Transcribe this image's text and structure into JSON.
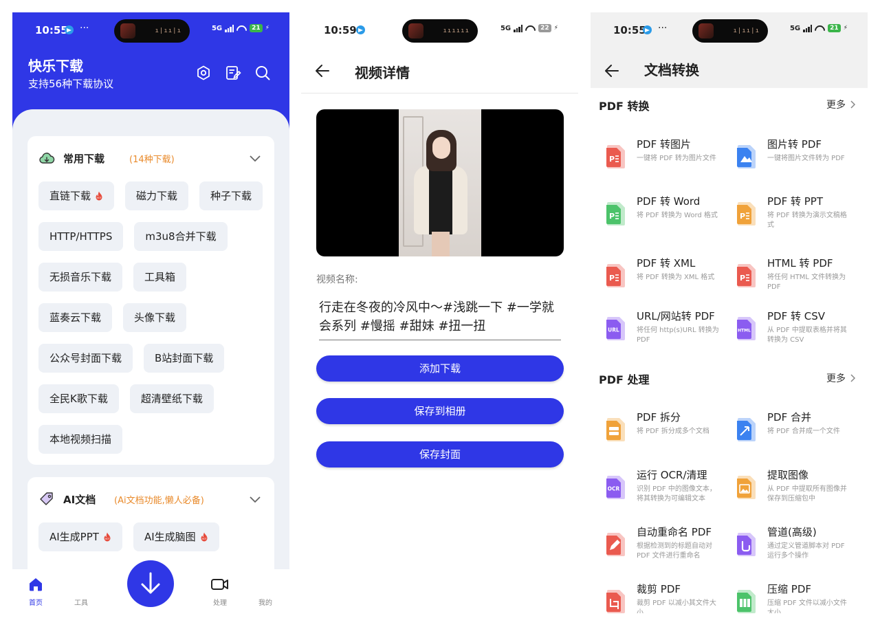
{
  "panel1": {
    "status": {
      "time": "10:55",
      "dots": "···",
      "network": "5G",
      "battery": "21"
    },
    "header": {
      "title": "快乐下载",
      "subtitle": "支持56种下载协议"
    },
    "sections": [
      {
        "title": "常用下载",
        "note": "(14种下载)",
        "chips": [
          {
            "label": "直链下载",
            "hot": true
          },
          {
            "label": "磁力下载",
            "hot": false
          },
          {
            "label": "种子下载",
            "hot": false
          },
          {
            "label": "HTTP/HTTPS",
            "hot": false
          },
          {
            "label": "m3u8合并下载",
            "hot": false
          },
          {
            "label": "无损音乐下载",
            "hot": false
          },
          {
            "label": "工具箱",
            "hot": false
          },
          {
            "label": "蓝奏云下载",
            "hot": false
          },
          {
            "label": "头像下载",
            "hot": false
          },
          {
            "label": "公众号封面下载",
            "hot": false
          },
          {
            "label": "B站封面下载",
            "hot": false
          },
          {
            "label": "全民K歌下载",
            "hot": false
          },
          {
            "label": "超清壁纸下载",
            "hot": false
          },
          {
            "label": "本地视频扫描",
            "hot": false
          }
        ]
      },
      {
        "title": "AI文档",
        "note": "(Ai文档功能,懒人必备)",
        "chips": [
          {
            "label": "AI生成PPT",
            "hot": true
          },
          {
            "label": "AI生成脑图",
            "hot": true
          }
        ]
      }
    ],
    "tabs": [
      {
        "label": "首页",
        "active": true
      },
      {
        "label": "工具",
        "active": false
      },
      {
        "label": "处理",
        "active": false
      },
      {
        "label": "我的",
        "active": false
      }
    ]
  },
  "panel2": {
    "status": {
      "time": "10:59",
      "network": "5G",
      "battery": "22"
    },
    "title": "视频详情",
    "name_label": "视频名称:",
    "name_value": "行走在冬夜的冷风中～#浅跳一下 #一学就会系列 #慢摇 #甜妹 #扭一扭",
    "buttons": [
      "添加下载",
      "保存到相册",
      "保存封面"
    ]
  },
  "panel3": {
    "status": {
      "time": "10:55",
      "dots": "···",
      "network": "5G",
      "battery": "21"
    },
    "title": "文档转换",
    "sections": [
      {
        "title": "PDF 转换",
        "more": "更多",
        "tools": [
          {
            "title": "PDF 转图片",
            "desc": "一键将 PDF 转为图片文件",
            "icon": "pdf-red-icon"
          },
          {
            "title": "图片转 PDF",
            "desc": "一键将图片文件转为 PDF",
            "icon": "image-blue-icon"
          },
          {
            "title": "PDF 转 Word",
            "desc": "将 PDF 转换为 Word 格式",
            "icon": "pdf-green-icon"
          },
          {
            "title": "PDF 转 PPT",
            "desc": "将 PDF 转换为演示文稿格式",
            "icon": "pdf-orange-icon"
          },
          {
            "title": "PDF 转 XML",
            "desc": "将 PDF 转换为 XML 格式",
            "icon": "pdf-red-icon"
          },
          {
            "title": "HTML 转 PDF",
            "desc": "将任何 HTML 文件转换为 PDF",
            "icon": "pdf-red-icon"
          },
          {
            "title": "URL/网站转 PDF",
            "desc": "将任何 http(s)URL 转换为 PDF",
            "icon": "url-purple-icon",
            "badge": "URL"
          },
          {
            "title": "PDF 转 CSV",
            "desc": "从 PDF 中提取表格并将其转换为 CSV",
            "icon": "html-purple-icon",
            "badge": "HTML"
          }
        ]
      },
      {
        "title": "PDF 处理",
        "more": "更多",
        "tools": [
          {
            "title": "PDF 拆分",
            "desc": "将 PDF 拆分成多个文档",
            "icon": "split-orange-icon"
          },
          {
            "title": "PDF 合并",
            "desc": "将 PDF 合并成一个文件",
            "icon": "merge-blue-icon"
          },
          {
            "title": "运行 OCR/清理",
            "desc": "识别 PDF 中的图像文本，将其转换为可编辑文本",
            "icon": "ocr-purple-icon",
            "badge": "OCR"
          },
          {
            "title": "提取图像",
            "desc": "从 PDF 中提取所有图像并保存到压缩包中",
            "icon": "image-orange-icon"
          },
          {
            "title": "自动重命名 PDF",
            "desc": "根据检测到的标题自动对 PDF 文件进行重命名",
            "icon": "rename-red-icon"
          },
          {
            "title": "管道(高级)",
            "desc": "通过定义管道脚本对 PDF 运行多个操作",
            "icon": "pipeline-purple-icon"
          },
          {
            "title": "裁剪 PDF",
            "desc": "裁剪 PDF 以减小其文件大小",
            "icon": "crop-red-icon"
          },
          {
            "title": "压缩 PDF",
            "desc": "压缩 PDF 文件以减小文件大小",
            "icon": "compress-green-icon"
          }
        ]
      }
    ]
  },
  "colors": {
    "primary": "#2f37e6",
    "accent_orange": "#e98a2b",
    "page_bg": "#eef1f6"
  }
}
